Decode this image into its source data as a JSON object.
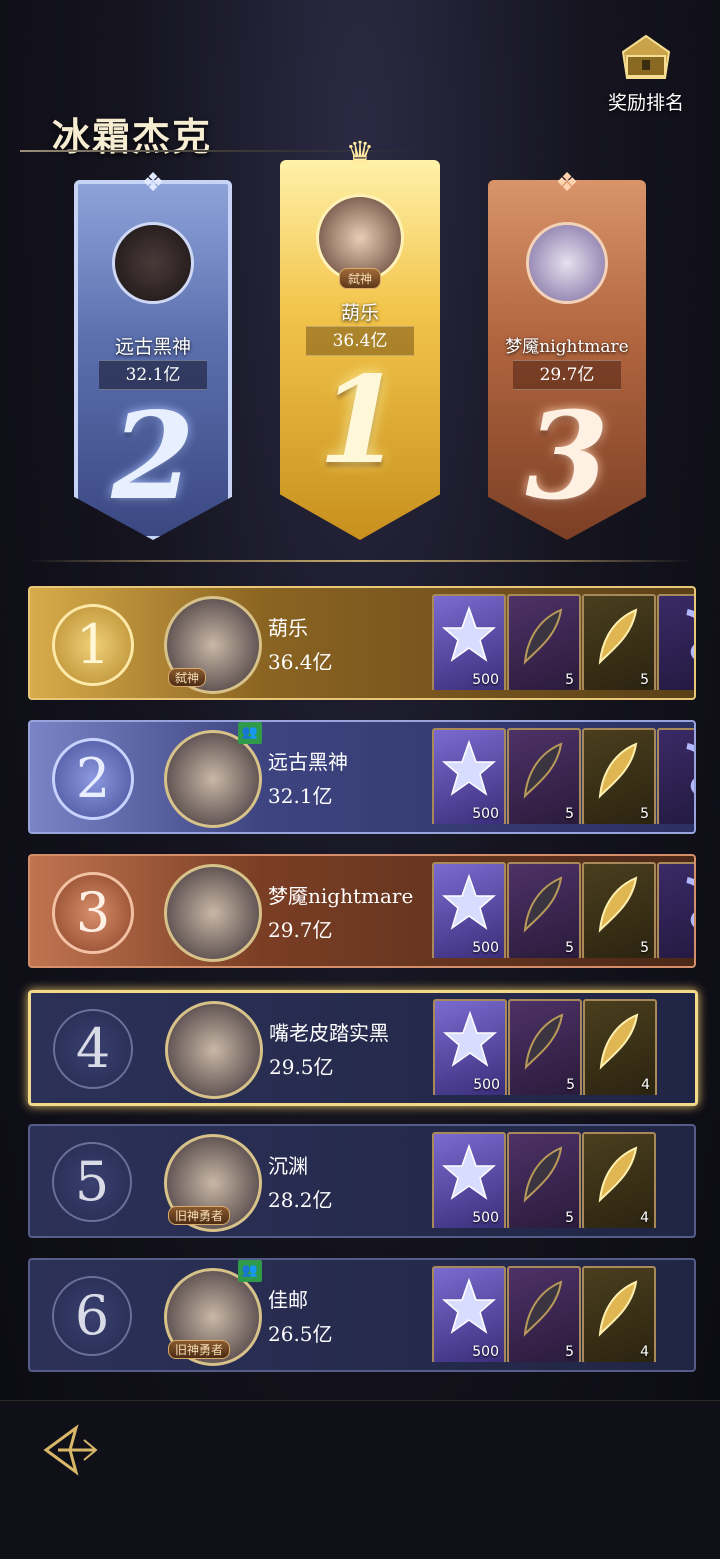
{
  "header": {
    "boss_title": "冰霜杰克",
    "reward_button_label": "奖励排名"
  },
  "podium": [
    {
      "rank": "2",
      "name": "远古黑神",
      "score": "32.1亿"
    },
    {
      "rank": "1",
      "name": "葫乐",
      "score": "36.4亿",
      "title_tag": "弑神"
    },
    {
      "rank": "3",
      "name": "梦魇nightmare",
      "score": "29.7亿"
    }
  ],
  "rankings": [
    {
      "rank": "1",
      "name": "葫乐",
      "score": "36.4亿",
      "tag": "弑神",
      "friend": false,
      "rewards": [
        {
          "type": "crystal",
          "qty": "500"
        },
        {
          "type": "dark-feather",
          "qty": "5"
        },
        {
          "type": "gold-feather",
          "qty": "5"
        },
        {
          "type": "dragon",
          "qty": ""
        }
      ]
    },
    {
      "rank": "2",
      "name": "远古黑神",
      "score": "32.1亿",
      "tag": "",
      "friend": true,
      "rewards": [
        {
          "type": "crystal",
          "qty": "500"
        },
        {
          "type": "dark-feather",
          "qty": "5"
        },
        {
          "type": "gold-feather",
          "qty": "5"
        },
        {
          "type": "dragon",
          "qty": ""
        }
      ]
    },
    {
      "rank": "3",
      "name": "梦魇nightmare",
      "score": "29.7亿",
      "tag": "",
      "friend": false,
      "rewards": [
        {
          "type": "crystal",
          "qty": "500"
        },
        {
          "type": "dark-feather",
          "qty": "5"
        },
        {
          "type": "gold-feather",
          "qty": "5"
        },
        {
          "type": "dragon",
          "qty": ""
        }
      ]
    },
    {
      "rank": "4",
      "name": "嘴老皮踏实黑",
      "score": "29.5亿",
      "tag": "",
      "friend": false,
      "self": true,
      "rewards": [
        {
          "type": "crystal",
          "qty": "500"
        },
        {
          "type": "dark-feather",
          "qty": "5"
        },
        {
          "type": "gold-feather",
          "qty": "4"
        }
      ]
    },
    {
      "rank": "5",
      "name": "沉渊",
      "score": "28.2亿",
      "tag": "旧神勇者",
      "friend": false,
      "rewards": [
        {
          "type": "crystal",
          "qty": "500"
        },
        {
          "type": "dark-feather",
          "qty": "5"
        },
        {
          "type": "gold-feather",
          "qty": "4"
        }
      ]
    },
    {
      "rank": "6",
      "name": "佳邮",
      "score": "26.5亿",
      "tag": "旧神勇者",
      "friend": true,
      "rewards": [
        {
          "type": "crystal",
          "qty": "500"
        },
        {
          "type": "dark-feather",
          "qty": "5"
        },
        {
          "type": "gold-feather",
          "qty": "4"
        }
      ]
    }
  ],
  "colors": {
    "gold": "#e8c878",
    "silver": "#9aa4dc",
    "bronze": "#d48e6a",
    "highlight": "#f3d98a"
  }
}
